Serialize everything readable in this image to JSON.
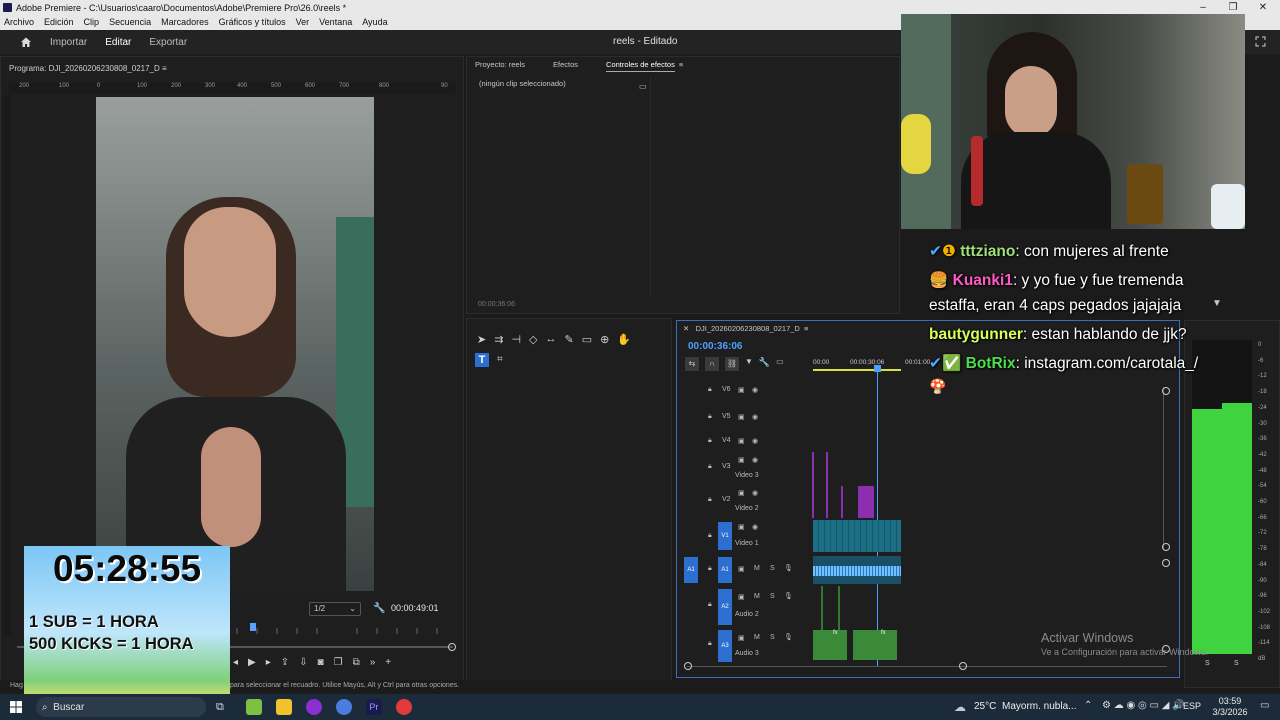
{
  "window": {
    "title": "Adobe Premiere - C:\\Usuarios\\caaro\\Documentos\\Adobe\\Premiere Pro\\26.0\\reels *",
    "min": "–",
    "max": "❐",
    "close": "✕"
  },
  "menu": [
    "Archivo",
    "Edición",
    "Clip",
    "Secuencia",
    "Marcadores",
    "Gráficos y títulos",
    "Ver",
    "Ventana",
    "Ayuda"
  ],
  "appbar": {
    "tabs": [
      "Importar",
      "Editar",
      "Exportar"
    ],
    "active_tab": "Editar",
    "project_title": "reels - Editado"
  },
  "program_monitor": {
    "title": "Programa: DJI_20260206230808_0217_D",
    "ruler_labels": [
      "200",
      "100",
      "0",
      "100",
      "200",
      "300",
      "400",
      "500",
      "600",
      "700",
      "800",
      "90"
    ],
    "resolution": "1/2",
    "timecode": "00:00:49:01",
    "playhead_fraction": 0.53
  },
  "effects_panel": {
    "tabs": [
      "Proyecto: reels",
      "Efectos",
      "Controles de efectos"
    ],
    "active_tab": "Controles de efectos",
    "empty_message": "(ningún clip seleccionado)",
    "timecode": "00:00:36:06"
  },
  "timeline": {
    "sequence": "DJI_20260206230808_0217_D",
    "timecode": "00:00:36:06",
    "ruler": [
      "00:00",
      "00:00:30:06",
      "00:01:00"
    ],
    "video_tracks": [
      {
        "id": "V6",
        "name": ""
      },
      {
        "id": "V5",
        "name": ""
      },
      {
        "id": "V4",
        "name": ""
      },
      {
        "id": "V3",
        "name": "Video 3"
      },
      {
        "id": "V2",
        "name": "Video 2"
      },
      {
        "id": "V1",
        "name": "Video 1"
      }
    ],
    "audio_tracks": [
      {
        "id": "A1",
        "name": ""
      },
      {
        "id": "A2",
        "name": "Audio 2"
      },
      {
        "id": "A3",
        "name": "Audio 3"
      }
    ],
    "mute_label": "M",
    "solo_label": "S",
    "clip_fx": "fx"
  },
  "meters": {
    "scale": [
      "0",
      "-6",
      "-12",
      "-18",
      "-24",
      "-30",
      "-36",
      "-42",
      "-48",
      "-54",
      "-60",
      "-66",
      "-72",
      "-78",
      "-84",
      "-90",
      "-96",
      "-102",
      "-108",
      "-114",
      "dB"
    ],
    "solo_labels": [
      "S",
      "S"
    ],
    "left_level": 0.78,
    "right_level": 0.8
  },
  "status_bar": {
    "left": "Hag",
    "message": "para seleccionar el recuadro. Utilice Mayús, Alt y Ctrl para otras opciones."
  },
  "activation": {
    "title": "Activar Windows",
    "subtitle": "Ve a Configuración para activar Windows."
  },
  "stream_overlay": {
    "timer": "05:28:55",
    "rule1": "1 SUB = 1 HORA",
    "rule2": "500 KICKS = 1 HORA"
  },
  "chat": [
    {
      "user": "tttziano",
      "text": " con mujeres al frente",
      "color": "#9ee07a"
    },
    {
      "user": "Kuanki1",
      "text": " y yo fue y fue tremenda",
      "color": "#ff5bc8"
    },
    {
      "user": "",
      "text": "estaffa, eran 4 caps pegados jajajaja",
      "color": "#ffffff"
    },
    {
      "user": "bautygunner",
      "text": " estan hablando de jjk?",
      "color": "#d9ff5a"
    },
    {
      "user": "BotRix",
      "text": " instagram.com/carotala_/",
      "color": "#4be04b"
    }
  ],
  "taskbar": {
    "search": "Buscar",
    "weather": "25°C",
    "weather_desc": "Mayorm. nubla...",
    "lang": "ESP",
    "time": "03:59",
    "date": "3/3/2026"
  },
  "colors": {
    "accent_blue": "#2d6fd1",
    "video_clip": "#1d6f86",
    "audio_clip": "#3a8a3a",
    "purple_clip": "#8b2fb0",
    "meter_green": "#3fd43f"
  }
}
